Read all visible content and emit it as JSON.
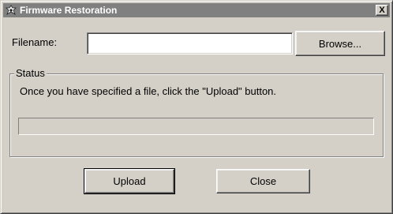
{
  "window": {
    "title": "Firmware Restoration",
    "close_glyph": "X"
  },
  "form": {
    "filename_label": "Filename:",
    "filename_value": "",
    "browse_label": "Browse..."
  },
  "status": {
    "group_label": "Status",
    "message": "Once you have specified a file, click the \"Upload\" button.",
    "progress": 0
  },
  "buttons": {
    "upload_label": "Upload",
    "close_label": "Close"
  },
  "icons": {
    "title": "firmware-restoration-icon"
  },
  "colors": {
    "titlebar": "#808080",
    "face": "#d4d0c8"
  }
}
